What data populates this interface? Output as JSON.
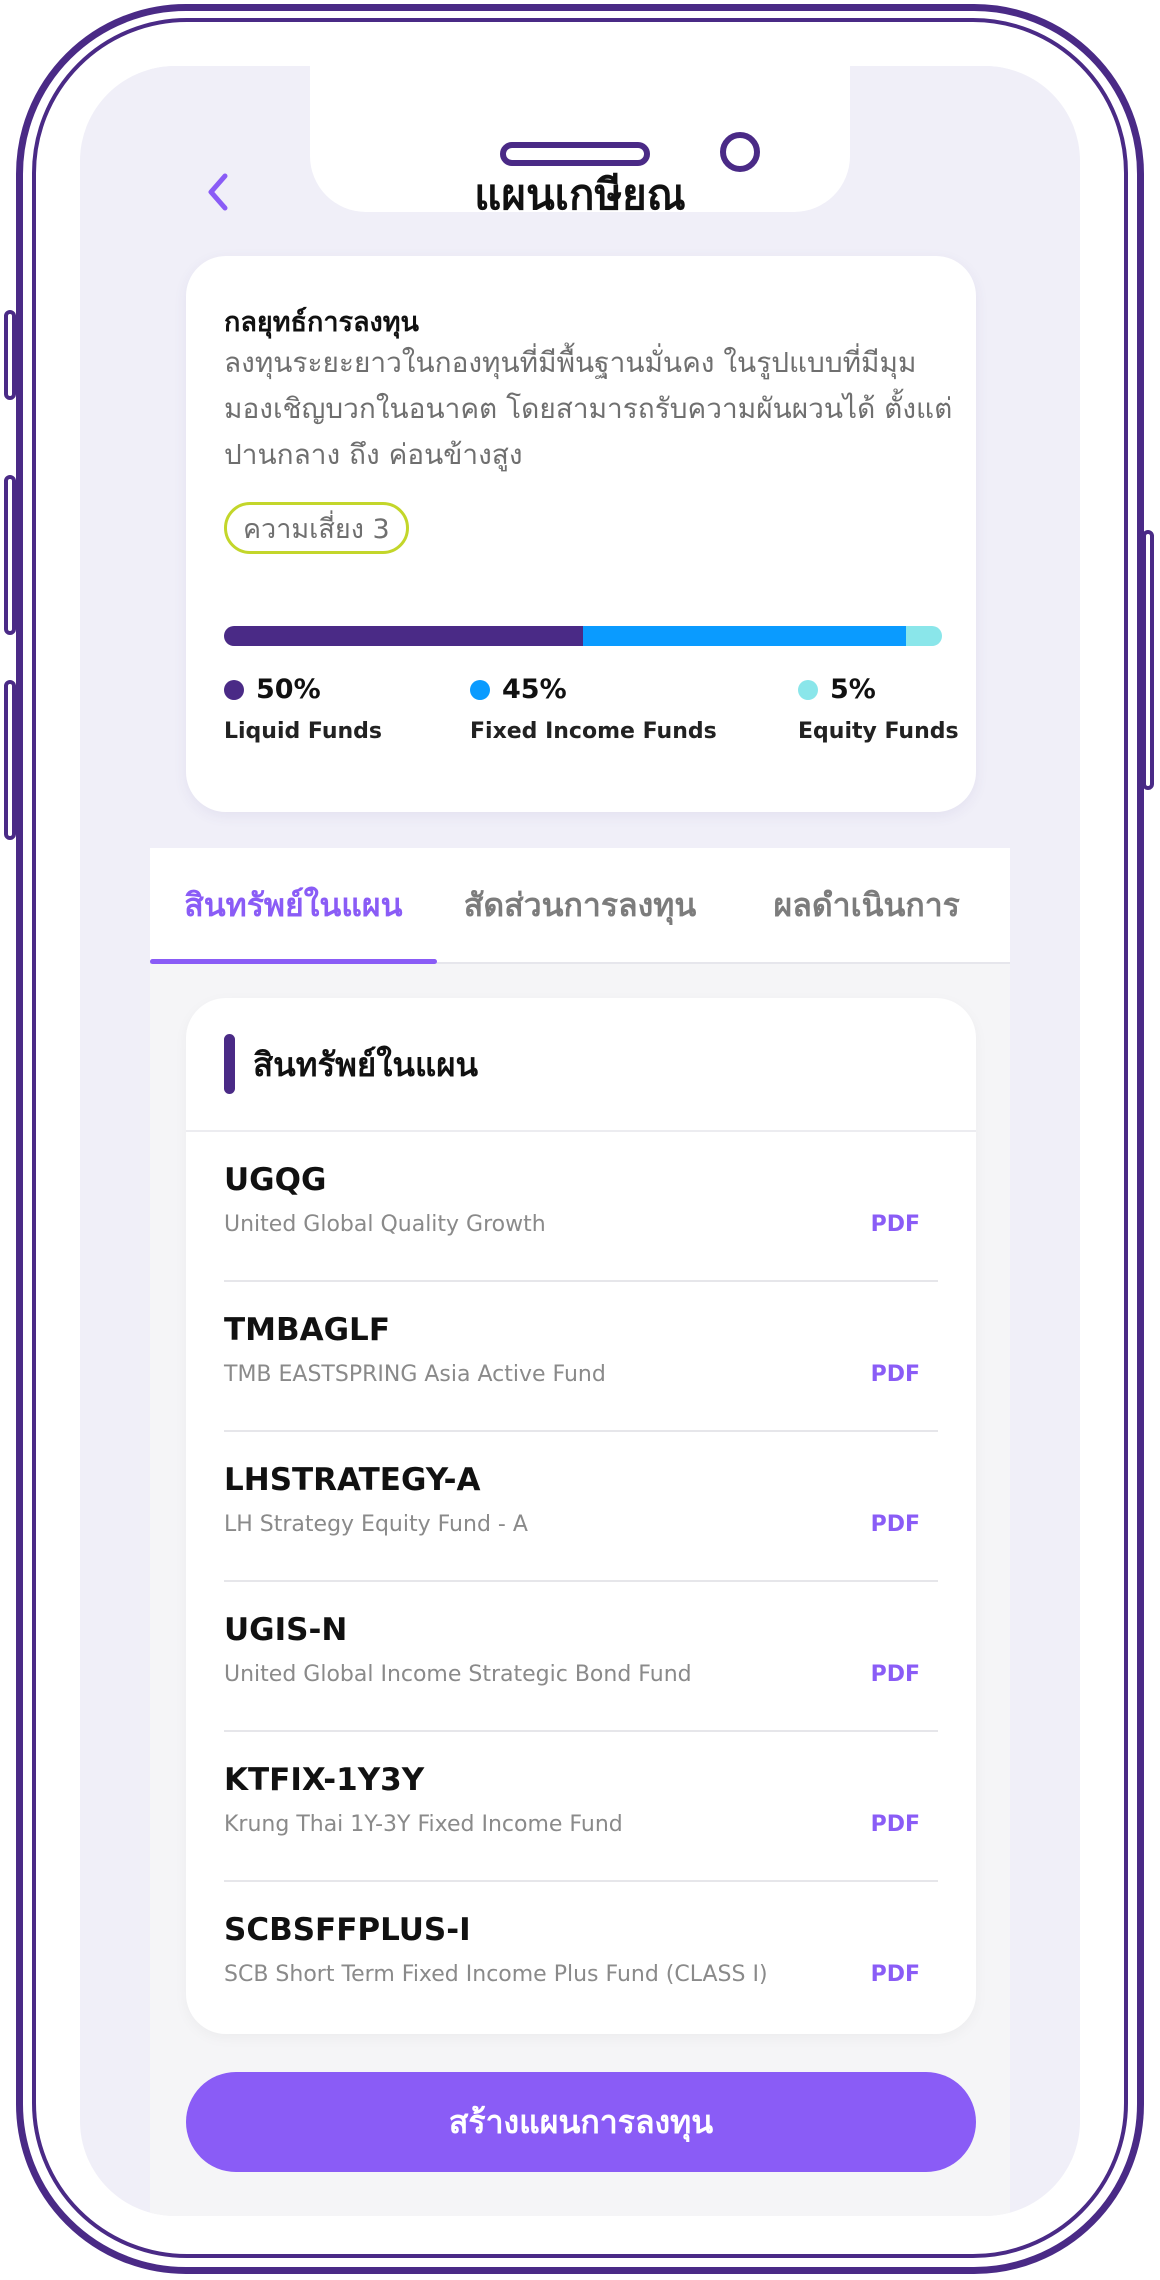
{
  "header": {
    "title": "แผนเกษียณ"
  },
  "strategy": {
    "title": "กลยุทธ์การลงทุน",
    "description": "ลงทุนระยะยาวในกองทุนที่มีพื้นฐานมั่นคง ในรูปแบบที่มีมุมมองเชิญบวกในอนาคต โดยสามารถรับความผันผวนได้ ตั้งแต่ปานกลาง ถึง ค่อนข้างสูง",
    "risk_label": "ความเสี่ยง 3"
  },
  "allocation": [
    {
      "percent_label": "50%",
      "percent": 50,
      "label": "Liquid Funds",
      "color": "#4a2a86"
    },
    {
      "percent_label": "45%",
      "percent": 45,
      "label": "Fixed Income Funds",
      "color": "#0a9bff"
    },
    {
      "percent_label": "5%",
      "percent": 5,
      "label": "Equity Funds",
      "color": "#8ae6ea"
    }
  ],
  "tabs": [
    {
      "label": "สินทรัพย์ในแผน",
      "active": true
    },
    {
      "label": "สัดส่วนการลงทุน",
      "active": false
    },
    {
      "label": "ผลดำเนินการ",
      "active": false
    }
  ],
  "assets": {
    "title": "สินทรัพย์ในแผน",
    "items": [
      {
        "code": "UGQG",
        "name": "United Global Quality Growth",
        "pdf_label": "PDF"
      },
      {
        "code": "TMBAGLF",
        "name": "TMB EASTSPRING Asia Active Fund",
        "pdf_label": "PDF"
      },
      {
        "code": "LHSTRATEGY-A",
        "name": "LH Strategy Equity Fund - A",
        "pdf_label": "PDF"
      },
      {
        "code": "UGIS-N",
        "name": "United Global Income Strategic Bond Fund",
        "pdf_label": "PDF"
      },
      {
        "code": "KTFIX-1Y3Y",
        "name": "Krung Thai 1Y-3Y Fixed Income Fund",
        "pdf_label": "PDF"
      },
      {
        "code": "SCBSFFPLUS-I",
        "name": "SCB Short Term Fixed Income Plus Fund (CLASS I)",
        "pdf_label": "PDF"
      }
    ]
  },
  "cta": {
    "label": "สร้างแผนการลงทุน"
  },
  "colors": {
    "accent": "#8a5cf6",
    "brand_dark": "#4a2a86",
    "risk_badge_border": "#c3d62a"
  },
  "icons": {
    "back": "chevron-left-icon"
  }
}
